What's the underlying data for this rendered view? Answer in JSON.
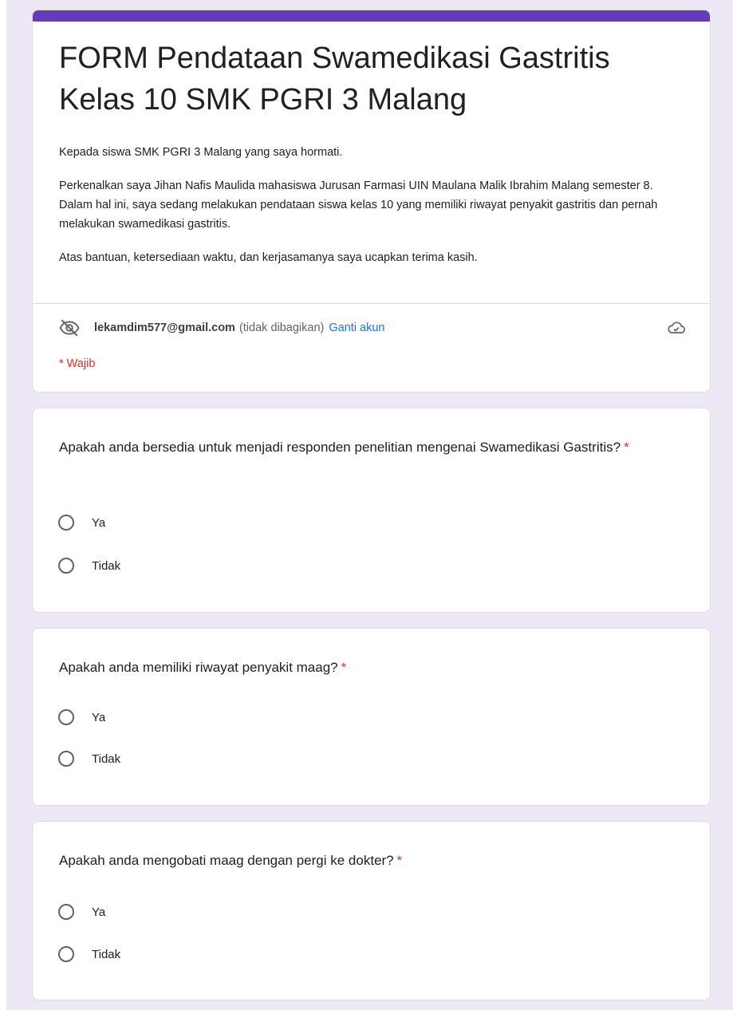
{
  "form": {
    "title": "FORM Pendataan Swamedikasi Gastritis Kelas 10 SMK PGRI 3 Malang",
    "description": [
      "Kepada siswa SMK PGRI 3 Malang yang saya hormati.",
      "Perkenalkan saya Jihan Nafis Maulida mahasiswa Jurusan Farmasi UIN Maulana Malik Ibrahim Malang semester 8. Dalam hal ini, saya sedang melakukan pendataan siswa kelas 10 yang memiliki riwayat penyakit gastritis dan pernah melakukan swamedikasi gastritis.",
      "Atas bantuan, ketersediaan waktu, dan kerjasamanya saya ucapkan terima kasih."
    ],
    "accent_color": "#673ab7",
    "background_color": "#ede7f6"
  },
  "account": {
    "email": "lekamdim577@gmail.com",
    "not_shared": "(tidak dibagikan)",
    "switch_label": "Ganti akun",
    "hidden_icon": "eye-off-icon",
    "cloud_icon": "cloud-done-icon"
  },
  "required_note": "* Wajib",
  "questions": [
    {
      "text": "Apakah anda bersedia untuk menjadi responden penelitian mengenai Swamedikasi Gastritis?",
      "asterisk": "*",
      "options": [
        "Ya",
        "Tidak"
      ]
    },
    {
      "text": "Apakah anda memiliki riwayat penyakit maag?",
      "asterisk": "*",
      "options": [
        "Ya",
        "Tidak"
      ]
    },
    {
      "text": "Apakah anda mengobati maag dengan pergi ke dokter?",
      "asterisk": "*",
      "options": [
        "Ya",
        "Tidak"
      ]
    }
  ]
}
